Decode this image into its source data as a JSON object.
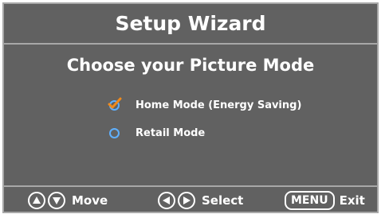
{
  "window": {
    "title": "Setup Wizard"
  },
  "main": {
    "heading": "Choose your Picture Mode",
    "options": [
      {
        "label": "Home Mode (Energy Saving)",
        "selected": true
      },
      {
        "label": "Retail Mode",
        "selected": false
      }
    ]
  },
  "footer": {
    "move_label": "Move",
    "select_label": "Select",
    "menu_key": "MENU",
    "exit_label": "Exit"
  },
  "colors": {
    "background": "#616161",
    "border": "#a8a8a8",
    "text": "#ffffff",
    "radio_ring": "#5fb0ff",
    "check_mark": "#f08a1c"
  },
  "icons": {
    "check": "check-icon",
    "up": "arrow-up-icon",
    "down": "arrow-down-icon",
    "left": "arrow-left-icon",
    "right": "arrow-right-icon"
  }
}
